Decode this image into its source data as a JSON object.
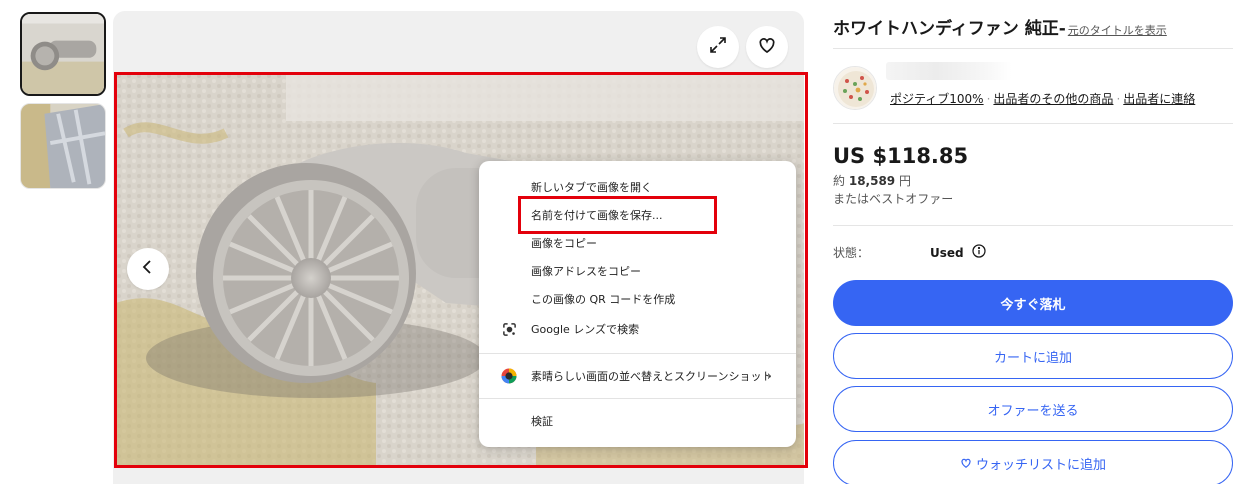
{
  "thumbnails": [
    {
      "name": "thumbnail-fan-side"
    },
    {
      "name": "thumbnail-fan-closeup"
    }
  ],
  "gallery": {
    "icons": {
      "expand": "expand-icon",
      "favorite": "heart-icon",
      "previous": "chevron-left-icon"
    }
  },
  "context_menu": {
    "items": [
      {
        "label": "新しいタブで画像を開く"
      },
      {
        "label": "名前を付けて画像を保存..."
      },
      {
        "label": "画像をコピー"
      },
      {
        "label": "画像アドレスをコピー"
      },
      {
        "label": "この画像の QR コードを作成"
      },
      {
        "label": "Google レンズで検索",
        "icon": "google-lens-icon"
      },
      {
        "label": "素晴らしい画面の並べ替えとスクリーンショット",
        "icon": "extension-icon"
      },
      {
        "label": "検証"
      }
    ]
  },
  "listing": {
    "title": "ホワイトハンディファン 純正-",
    "original_title_link": "元のタイトルを表示",
    "seller": {
      "positive": "ポジティブ100%",
      "other_items": "出品者のその他の商品",
      "contact": "出品者に連絡"
    },
    "price": "US $118.85",
    "approx_prefix": "約",
    "approx_value": "18,589",
    "approx_unit": "円",
    "best_offer": "またはベストオファー",
    "condition_label": "状態：",
    "condition_value": "Used",
    "buttons": {
      "bid": "今すぐ落札",
      "cart": "カートに追加",
      "offer": "オファーを送る",
      "watch": "ウォッチリストに追加"
    }
  },
  "colors": {
    "primary": "#3665f3",
    "highlight": "#e3000b",
    "text": "#191919"
  }
}
